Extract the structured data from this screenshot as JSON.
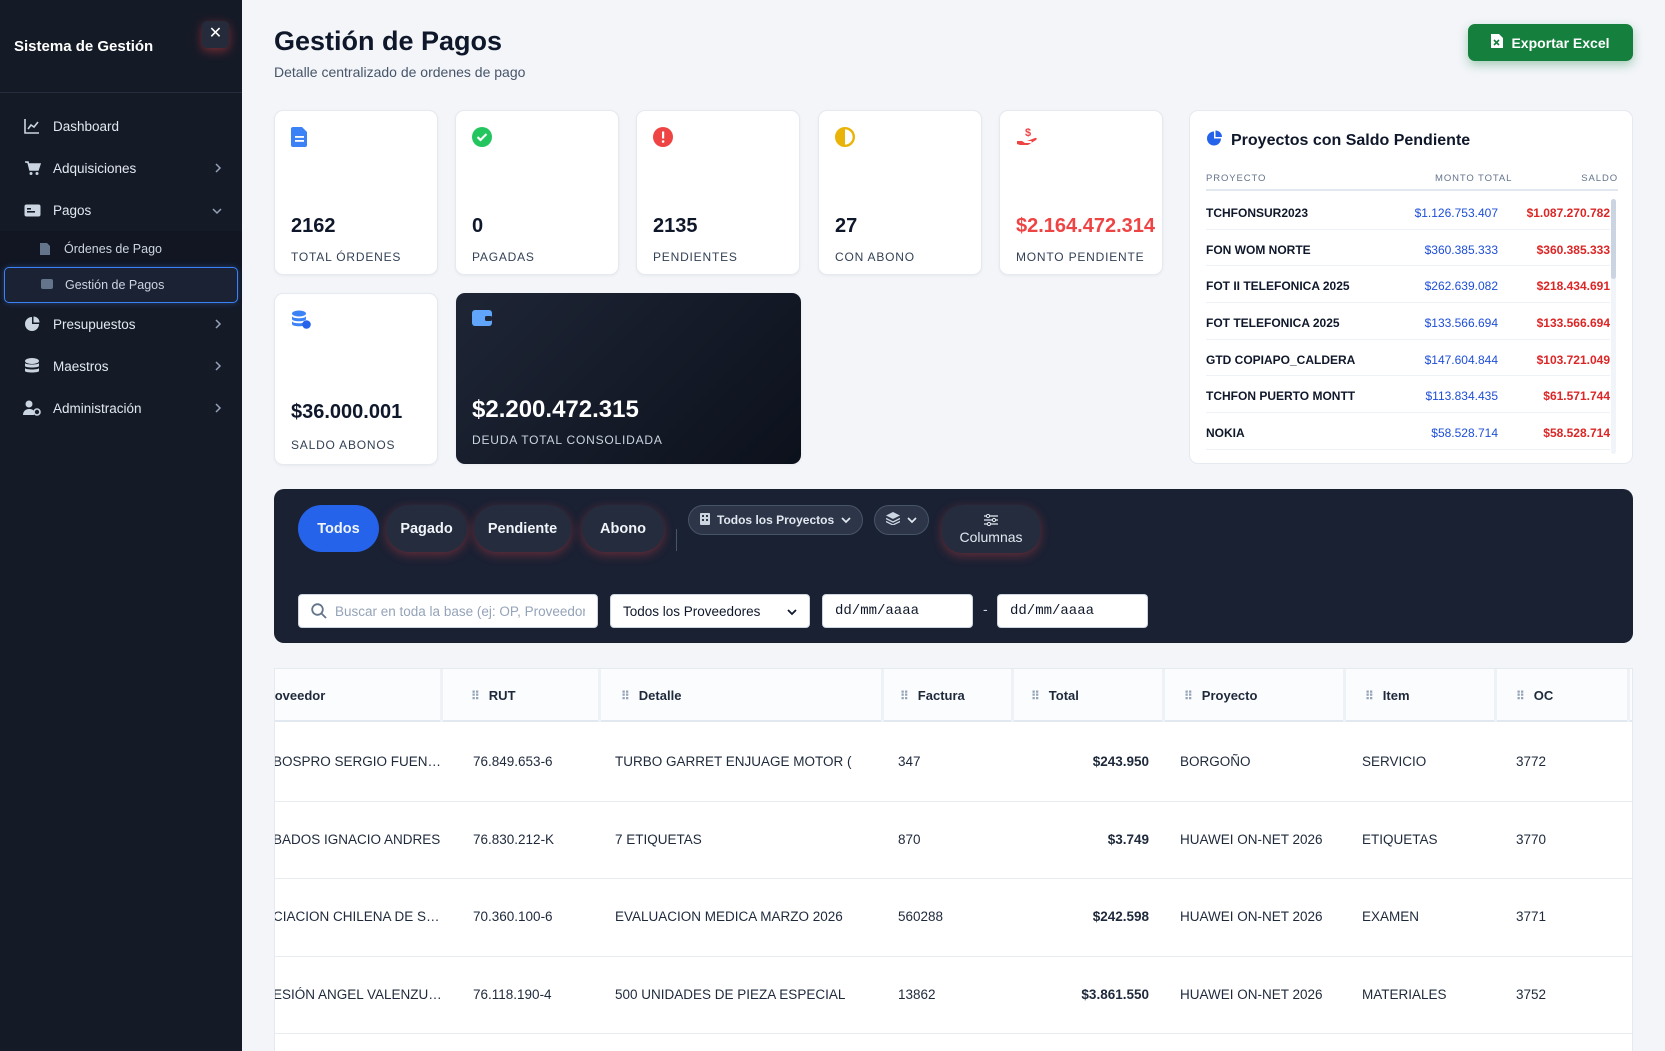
{
  "sidebar": {
    "title": "Sistema de Gestión",
    "close_label": "✕",
    "items": {
      "dashboard": "Dashboard",
      "adquisiciones": "Adquisiciones",
      "pagos": "Pagos",
      "ordenes": "Órdenes de Pago",
      "gestion": "Gestión de Pagos",
      "presupuestos": "Presupuestos",
      "maestros": "Maestros",
      "administracion": "Administración"
    }
  },
  "header": {
    "title": "Gestión de Pagos",
    "subtitle": "Detalle centralizado de ordenes de pago",
    "export_label": "Exportar Excel"
  },
  "stats": [
    {
      "value": "2162",
      "label": "TOTAL ÓRDENES",
      "icon": "document-icon",
      "color": "#3b82f6"
    },
    {
      "value": "0",
      "label": "PAGADAS",
      "icon": "check-circle-icon",
      "color": "#22c55e"
    },
    {
      "value": "2135",
      "label": "PENDIENTES",
      "icon": "alert-circle-icon",
      "color": "#ef4444"
    },
    {
      "value": "27",
      "label": "CON ABONO",
      "icon": "half-circle-icon",
      "color": "#eab308"
    },
    {
      "value": "$2.164.472.314",
      "label": "MONTO PENDIENTE",
      "icon": "hand-dollar-icon",
      "color": "#ef4444"
    },
    {
      "value": "$36.000.001",
      "label": "SALDO ABONOS",
      "icon": "coins-icon",
      "color": "#3b82f6"
    },
    {
      "value": "$2.200.472.315",
      "label": "DEUDA TOTAL CONSOLIDADA",
      "icon": "wallet-icon",
      "color": "#60a5fa"
    }
  ],
  "projects": {
    "title": "Proyectos con Saldo Pendiente",
    "headers": {
      "proyecto": "PROYECTO",
      "monto": "MONTO TOTAL",
      "saldo": "SALDO"
    },
    "rows": [
      {
        "name": "TCHFONSUR2023",
        "monto": "$1.126.753.407",
        "saldo": "$1.087.270.782"
      },
      {
        "name": "FON WOM NORTE",
        "monto": "$360.385.333",
        "saldo": "$360.385.333"
      },
      {
        "name": "FOT II TELEFONICA 2025",
        "monto": "$262.639.082",
        "saldo": "$218.434.691"
      },
      {
        "name": "FOT TELEFONICA 2025",
        "monto": "$133.566.694",
        "saldo": "$133.566.694"
      },
      {
        "name": "GTD COPIAPO_CALDERA",
        "monto": "$147.604.844",
        "saldo": "$103.721.049"
      },
      {
        "name": "TCHFON PUERTO MONTT",
        "monto": "$113.834.435",
        "saldo": "$61.571.744"
      },
      {
        "name": "NOKIA",
        "monto": "$58.528.714",
        "saldo": "$58.528.714"
      }
    ]
  },
  "filters": {
    "tabs": [
      "Todos",
      "Pagado",
      "Pendiente",
      "Abono"
    ],
    "projects_dropdown": "Todos los Proyectos",
    "columns_label": "Columnas",
    "search_placeholder": "Buscar en toda la base (ej: OP, Proveedor...)",
    "provider_select": "Todos los Proveedores",
    "date_from": "dd/mm/aaaa",
    "date_to": "dd/mm/aaaa",
    "date_sep": "-"
  },
  "table": {
    "headers": {
      "proveedor": "Proveedor",
      "rut": "RUT",
      "detalle": "Detalle",
      "factura": "Factura",
      "total": "Total",
      "proyecto": "Proyecto",
      "item": "Item",
      "oc": "OC"
    },
    "rows": [
      {
        "proveedor": "BOSPRO SERGIO FUENTES",
        "rut": "76.849.653-6",
        "detalle": "TURBO GARRET ENJUAGE MOTOR (",
        "factura": "347",
        "total": "$243.950",
        "proyecto": "BORGOÑO",
        "item": "SERVICIO",
        "oc": "3772"
      },
      {
        "proveedor": "BADOS IGNACIO ANDRES",
        "rut": "76.830.212-K",
        "detalle": "7 ETIQUETAS",
        "factura": "870",
        "total": "$3.749",
        "proyecto": "HUAWEI ON-NET 2026",
        "item": "ETIQUETAS",
        "oc": "3770"
      },
      {
        "proveedor": "CIACION CHILENA DE SEGURIDAD",
        "rut": "70.360.100-6",
        "detalle": "EVALUACION MEDICA MARZO 2026",
        "factura": "560288",
        "total": "$242.598",
        "proyecto": "HUAWEI ON-NET 2026",
        "item": "EXAMEN",
        "oc": "3771"
      },
      {
        "proveedor": "ESIÓN ANGEL VALENZUELA",
        "rut": "76.118.190-4",
        "detalle": "500 UNIDADES DE PIEZA ESPECIAL ",
        "factura": "13862",
        "total": "$3.861.550",
        "proyecto": "HUAWEI ON-NET 2026",
        "item": "MATERIALES",
        "oc": "3752"
      }
    ]
  }
}
